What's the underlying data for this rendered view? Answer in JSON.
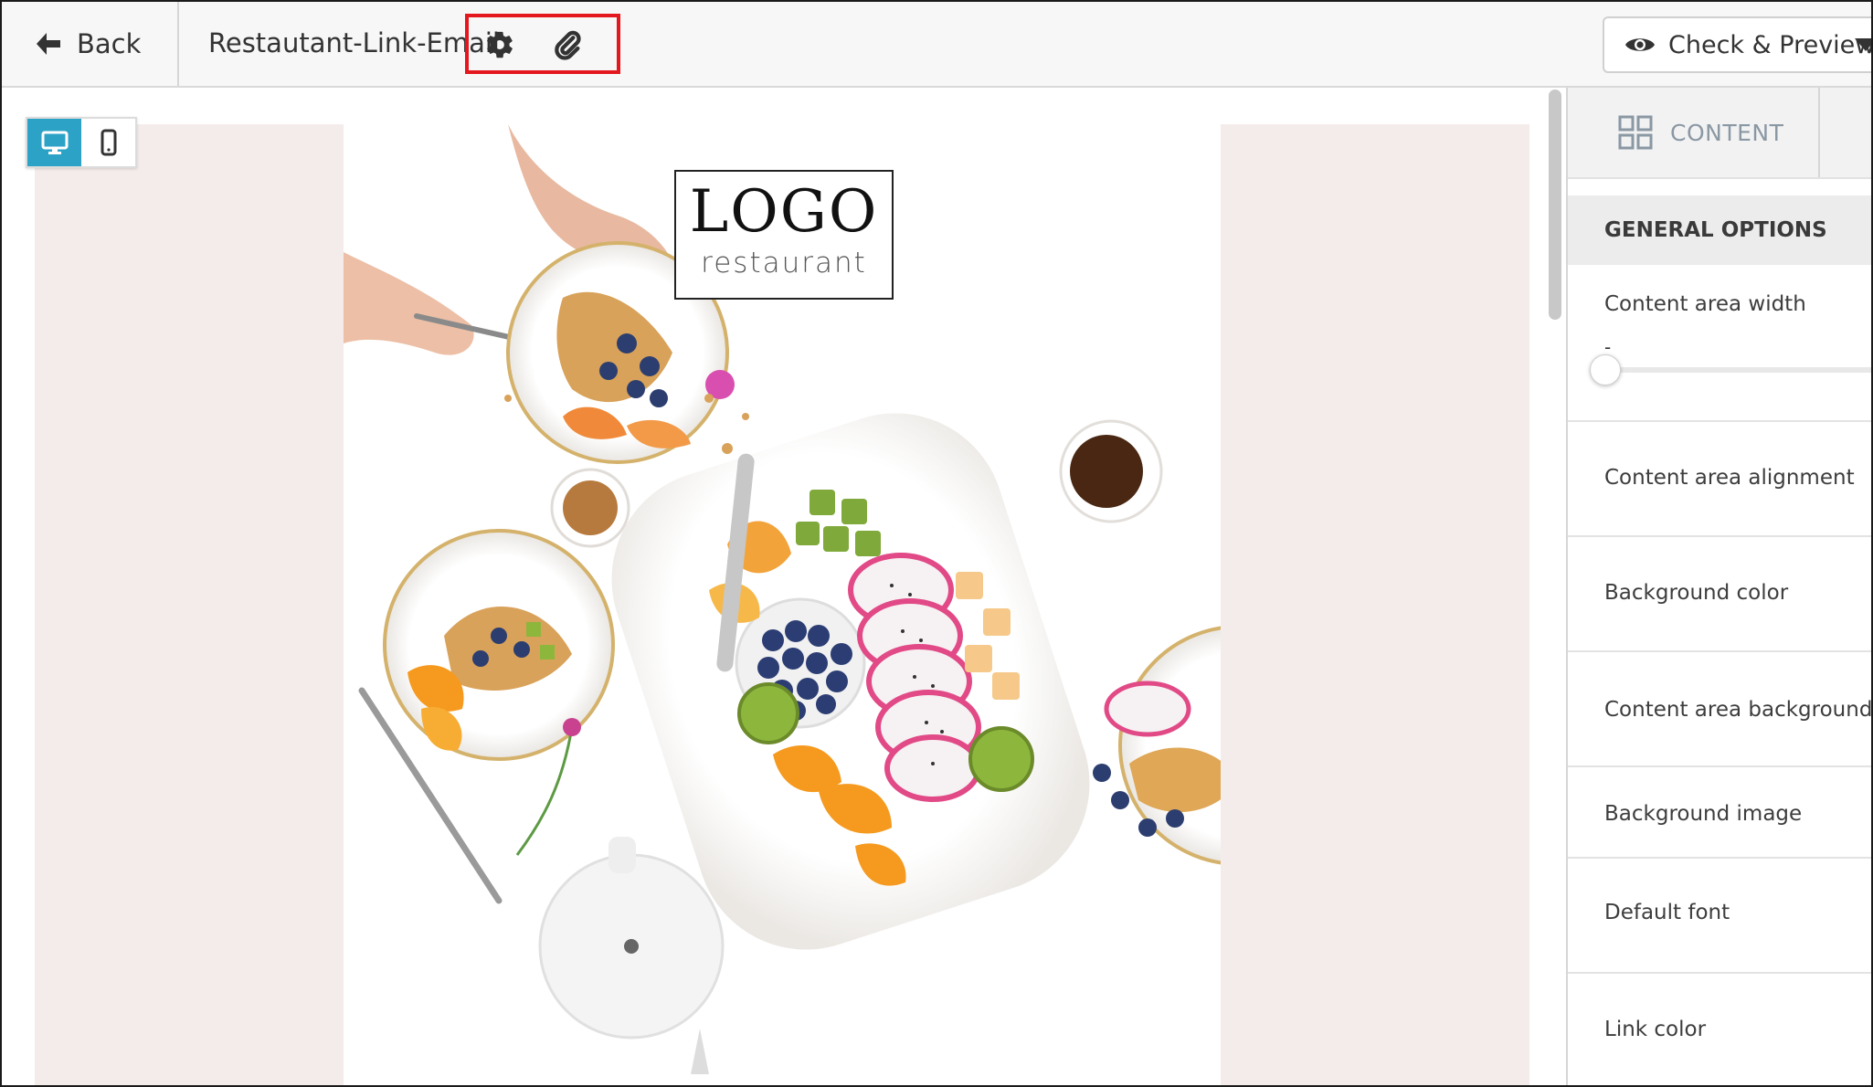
{
  "app": {
    "back_label": "Back",
    "document_title": "Restautant-Link-Email",
    "toolbar_icons": [
      "gear-icon",
      "paperclip-icon"
    ],
    "preview_label": "Check & Preview"
  },
  "canvas": {
    "device_modes": [
      "desktop",
      "mobile"
    ],
    "active_device": "desktop",
    "logo": {
      "main": "LOGO",
      "sub": "restaurant"
    },
    "colors": {
      "email_background": "#f4ecea",
      "content_area": "#ffffff",
      "accent": "#2ca3c6",
      "highlight": "#e4171f"
    }
  },
  "panel": {
    "tab_label": "CONTENT",
    "section_title": "GENERAL OPTIONS",
    "options": [
      {
        "label": "Content area width",
        "value": "-"
      },
      {
        "label": "Content area alignment"
      },
      {
        "label": "Background color"
      },
      {
        "label": "Content area background color"
      },
      {
        "label": "Background image"
      },
      {
        "label": "Default font"
      },
      {
        "label": "Link color"
      }
    ]
  }
}
